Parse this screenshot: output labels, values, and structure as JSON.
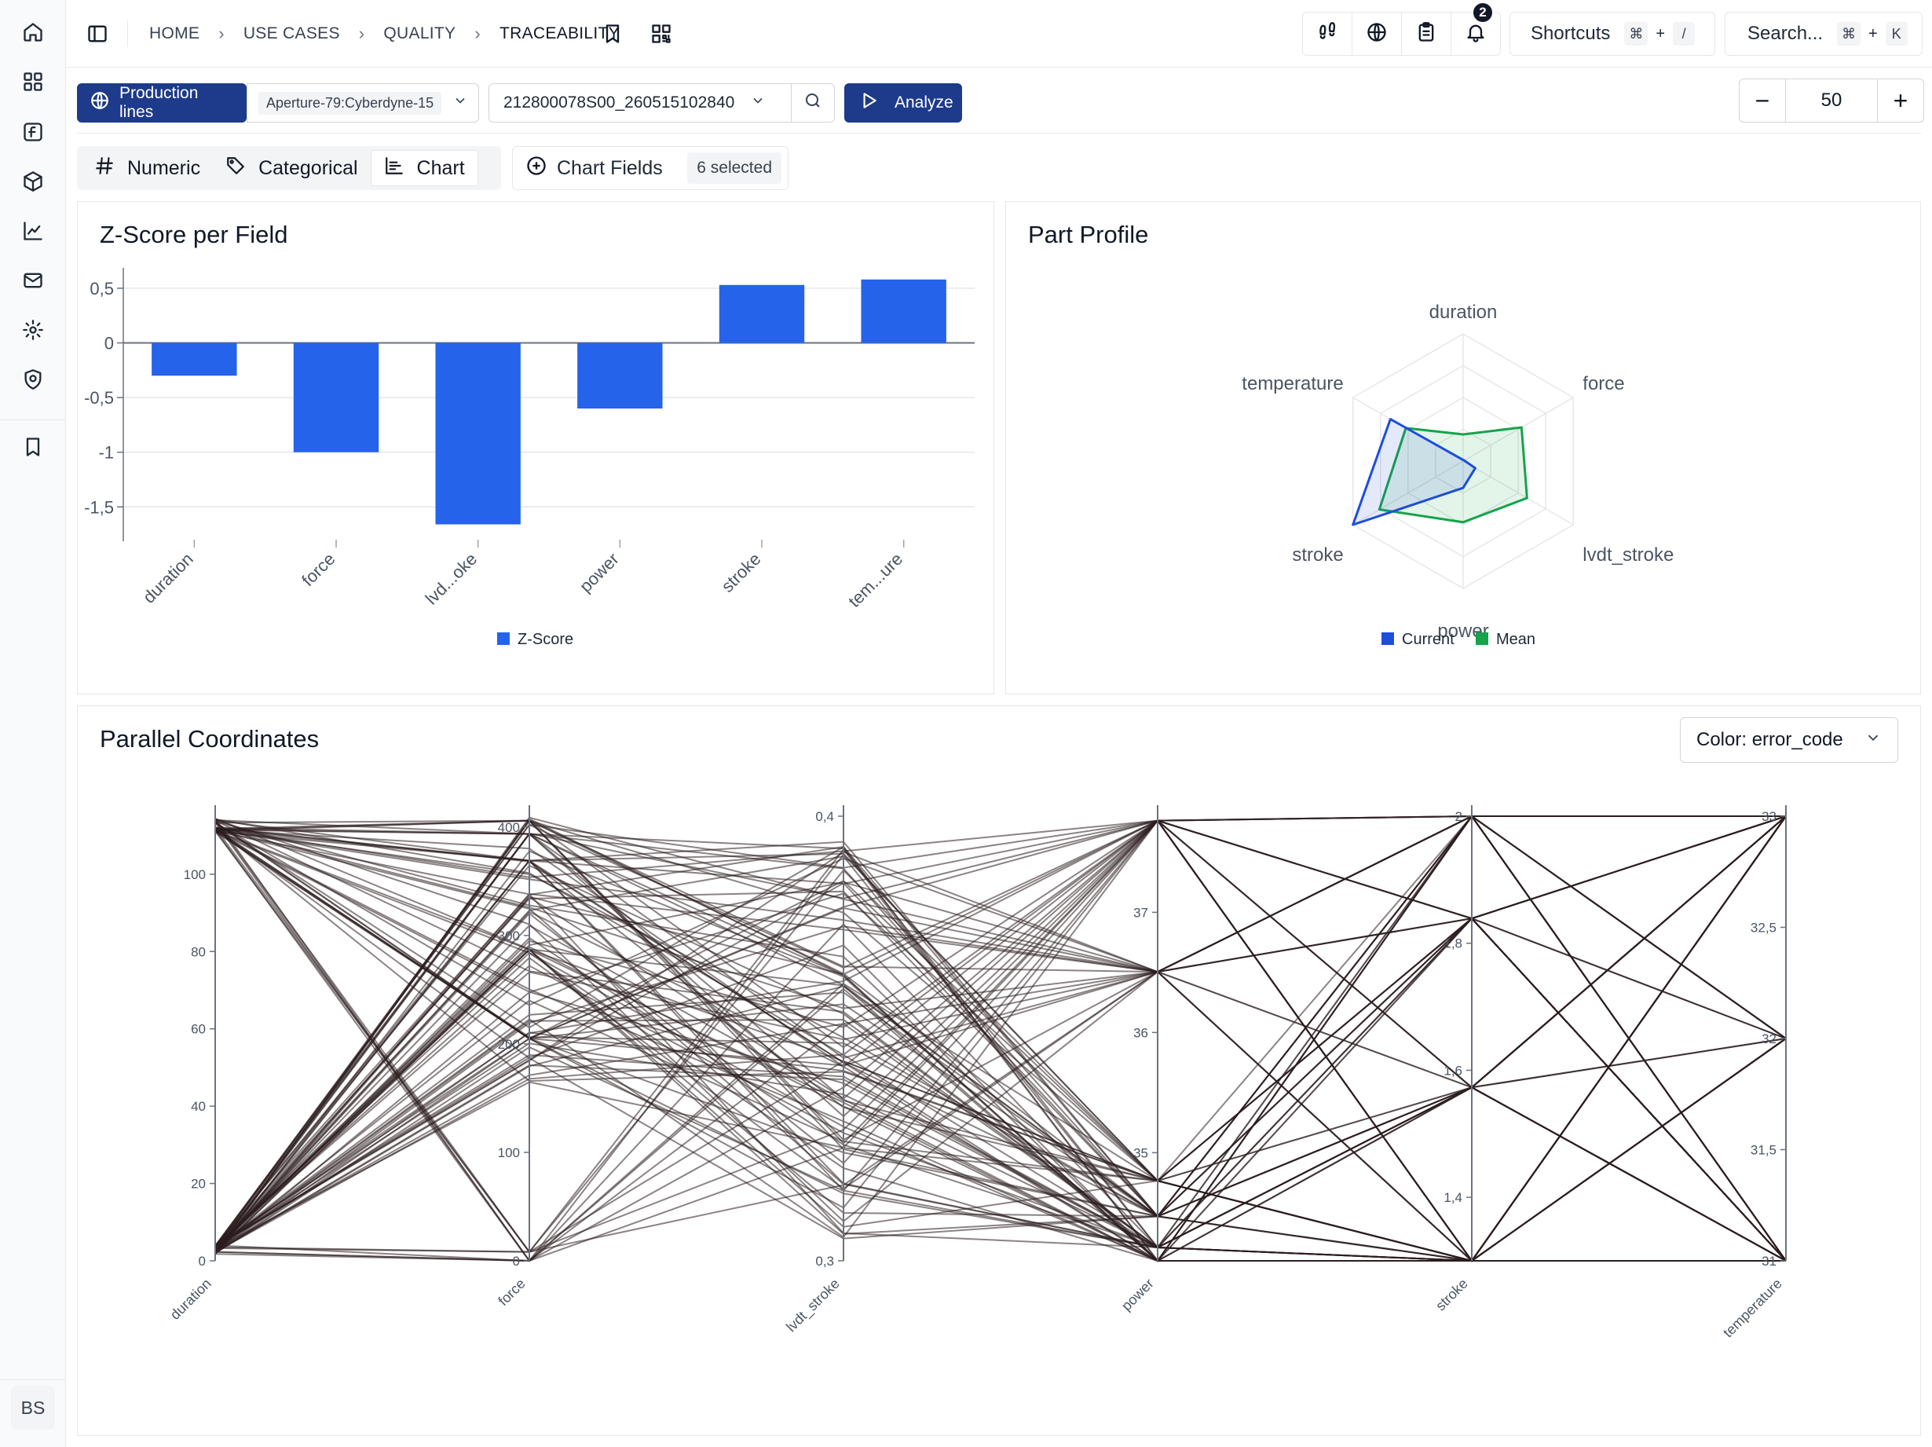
{
  "header": {
    "breadcrumbs": [
      "HOME",
      "USE CASES",
      "QUALITY",
      "TRACEABILITY"
    ],
    "notification_count": "2",
    "shortcuts_label": "Shortcuts",
    "shortcuts_key1": "⌘",
    "shortcuts_plus": "+",
    "shortcuts_key2": "/",
    "search_label": "Search...",
    "search_key1": "⌘",
    "search_plus": "+",
    "search_key2": "K"
  },
  "toolbar": {
    "production_lines_label": "Production lines",
    "line_value": "Aperture-79:Cyberdyne-15",
    "part_value": "212800078S00_260515102840",
    "analyze_label": "Analyze",
    "stepper_minus": "−",
    "stepper_value": "50",
    "stepper_plus": "+"
  },
  "tabs": {
    "numeric": "Numeric",
    "categorical": "Categorical",
    "chart": "Chart",
    "chart_fields": "Chart Fields",
    "selected_count": "6 selected"
  },
  "sidebar": {
    "icons": [
      "home-icon",
      "grid-icon",
      "function-icon",
      "cube-icon",
      "chart-line-icon",
      "mail-icon",
      "settings-icon",
      "shield-icon",
      "bookmark-icon"
    ],
    "avatar_initials": "BS"
  },
  "colors": {
    "primary": "#1e3a8a",
    "bar": "#2563eb",
    "current": "#1d4ed8",
    "mean": "#16a34a",
    "parallel_line": "#2b1d1f"
  },
  "chart_data": [
    {
      "type": "bar",
      "title": "Z-Score per Field",
      "categories": [
        "duration",
        "force",
        "lvd...oke",
        "power",
        "stroke",
        "tem...ure"
      ],
      "series": [
        {
          "name": "Z-Score",
          "values": [
            -0.3,
            -1.0,
            -1.66,
            -0.6,
            0.53,
            0.58
          ]
        }
      ],
      "yticks": [
        "0,5",
        "0",
        "-0,5",
        "-1",
        "-1,5"
      ],
      "ylim": [
        -1.8,
        0.6
      ],
      "grid": true,
      "legend": "bottom"
    },
    {
      "type": "radar",
      "title": "Part Profile",
      "axes": [
        "duration",
        "force",
        "lvdt_stroke",
        "power",
        "stroke",
        "temperature"
      ],
      "series": [
        {
          "name": "Current",
          "values": [
            0.01,
            0.01,
            0.11,
            0.21,
            1.0,
            0.66
          ]
        },
        {
          "name": "Mean",
          "values": [
            0.21,
            0.53,
            0.58,
            0.48,
            0.76,
            0.52
          ]
        }
      ],
      "legend": "bottom"
    },
    {
      "type": "parallel",
      "title": "Parallel Coordinates",
      "color_selector": "Color: error_code",
      "axes": [
        {
          "name": "duration",
          "range": [
            0,
            115
          ],
          "ticks": [
            "0",
            "20",
            "40",
            "60",
            "80",
            "100"
          ],
          "tick_values": [
            0,
            20,
            40,
            60,
            80,
            100
          ]
        },
        {
          "name": "force",
          "range": [
            0,
            410
          ],
          "ticks": [
            "0",
            "100",
            "200",
            "300",
            "400"
          ],
          "tick_values": [
            0,
            100,
            200,
            300,
            400
          ]
        },
        {
          "name": "lvdt_stroke",
          "range": [
            0.3,
            0.4
          ],
          "ticks": [
            "0,3",
            "0,4"
          ],
          "tick_values": [
            0.3,
            0.4
          ]
        },
        {
          "name": "power",
          "range": [
            34.1,
            37.8
          ],
          "ticks": [
            "35",
            "36",
            "37"
          ],
          "tick_values": [
            35,
            36,
            37
          ]
        },
        {
          "name": "stroke",
          "range": [
            1.3,
            2.0
          ],
          "ticks": [
            "1,4",
            "1,6",
            "1,8",
            "2"
          ],
          "tick_values": [
            1.4,
            1.6,
            1.8,
            2.0
          ]
        },
        {
          "name": "temperature",
          "range": [
            31,
            33
          ],
          "ticks": [
            "31",
            "31,5",
            "32",
            "32,5",
            "33"
          ],
          "tick_values": [
            31,
            31.5,
            32,
            32.5,
            33
          ]
        }
      ]
    }
  ]
}
